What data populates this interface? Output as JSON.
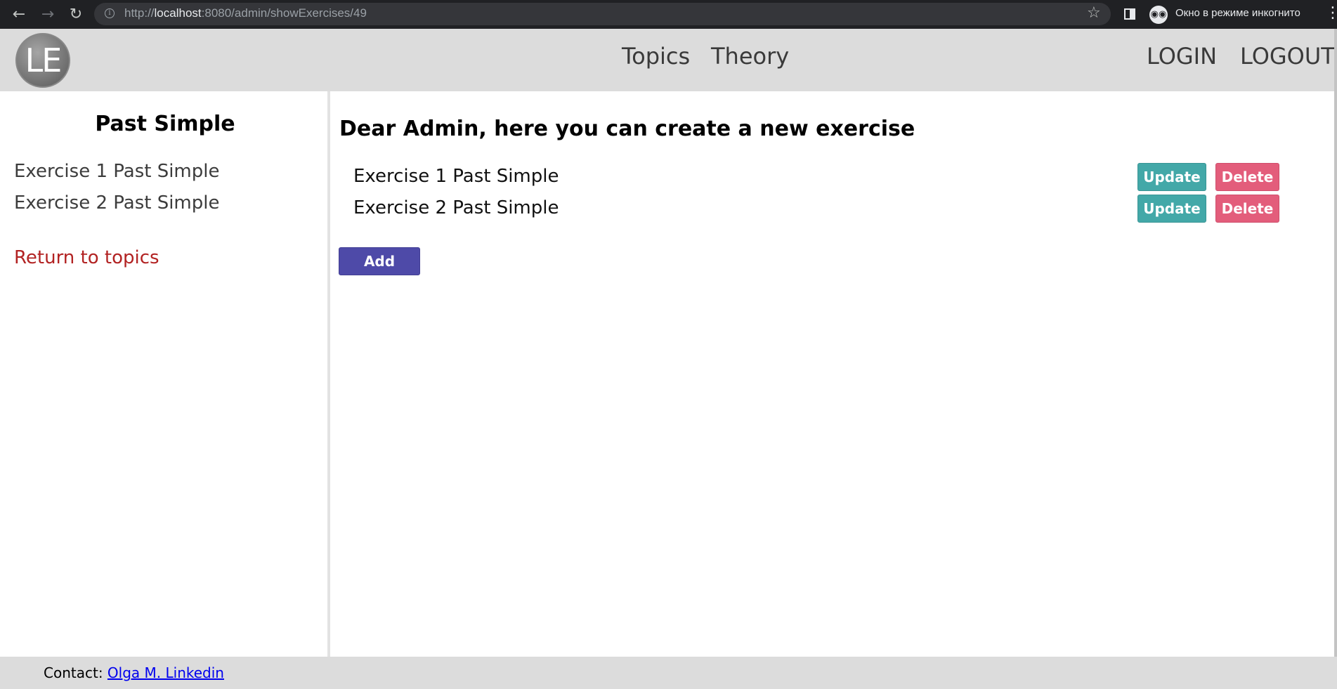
{
  "browser": {
    "url_prefix": "http://",
    "url_host": "localhost",
    "url_rest": ":8080/admin/showExercises/49",
    "incognito_label": "Окно в режиме инкогнито"
  },
  "header": {
    "logo_text": "LE",
    "nav": [
      "Topics",
      "Theory"
    ],
    "login": "LOGIN",
    "logout": "LOGOUT"
  },
  "sidebar": {
    "title": "Past Simple",
    "items": [
      "Exercise 1 Past Simple",
      "Exercise 2 Past Simple"
    ],
    "return_link": "Return to topics"
  },
  "main": {
    "heading": "Dear Admin, here you can create a new exercise",
    "exercises": [
      {
        "title": "Exercise 1 Past Simple",
        "update": "Update",
        "delete": "Delete"
      },
      {
        "title": "Exercise 2 Past Simple",
        "update": "Update",
        "delete": "Delete"
      }
    ],
    "add_label": "Add"
  },
  "footer": {
    "contact_label": "Contact:",
    "contact_link": "Olga M. Linkedin"
  },
  "colors": {
    "header_bg": "#dcdcdc",
    "update_btn": "#43a8a8",
    "delete_btn": "#e35d7b",
    "add_btn": "#4e4aa8",
    "return_link": "#b22222"
  }
}
